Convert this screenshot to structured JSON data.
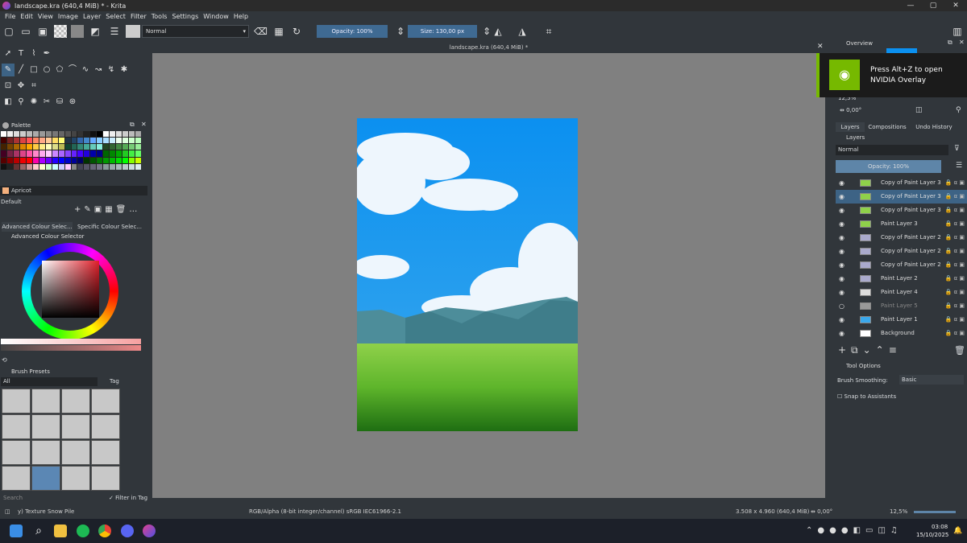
{
  "window": {
    "title": "landscape.kra (640,4 MiB) * - Krita",
    "min": "—",
    "max": "▢",
    "close": "✕"
  },
  "menu": [
    "File",
    "Edit",
    "View",
    "Image",
    "Layer",
    "Select",
    "Filter",
    "Tools",
    "Settings",
    "Window",
    "Help"
  ],
  "toolbar": {
    "blend_mode": "Normal",
    "opacity": "Opacity: 100%",
    "size": "Size: 130,00 px"
  },
  "canvas": {
    "tab_title": "landscape.kra (640,4 MiB) *"
  },
  "palette": {
    "title": "Palette",
    "selected_color": "Apricot",
    "palette_name": "Default"
  },
  "colour_tabs": {
    "tab1": "Advanced Colour Selec...",
    "tab2": "Specific Colour Selec..."
  },
  "adv_selector": {
    "title": "Advanced Colour Selector"
  },
  "brush_presets": {
    "title": "Brush Presets",
    "filter": "All",
    "tag": "Tag",
    "search_placeholder": "Search",
    "filter_in_tag": "Filter in Tag"
  },
  "overview": {
    "title": "Overview",
    "zoom": "12,5%",
    "rotation": "0,00°"
  },
  "right_tabs": [
    "Layers",
    "Compositions",
    "Undo History"
  ],
  "layers_panel": {
    "title": "Layers",
    "blend": "Normal",
    "opacity": "Opacity:  100%"
  },
  "layers": [
    {
      "name": "Copy of Paint Layer 3",
      "selected": false
    },
    {
      "name": "Copy of Paint Layer 3",
      "selected": true
    },
    {
      "name": "Copy of Paint Layer 3",
      "selected": false
    },
    {
      "name": "Paint Layer 3",
      "selected": false
    },
    {
      "name": "Copy of Paint Layer 2",
      "selected": false
    },
    {
      "name": "Copy of Paint Layer 2",
      "selected": false
    },
    {
      "name": "Copy of Paint Layer 2",
      "selected": false
    },
    {
      "name": "Paint Layer 2",
      "selected": false
    },
    {
      "name": "Paint Layer 4",
      "selected": false
    },
    {
      "name": "Paint Layer 5",
      "selected": false
    },
    {
      "name": "Paint Layer 1",
      "selected": false
    },
    {
      "name": "Background",
      "selected": false
    }
  ],
  "tool_options": {
    "title": "Tool Options",
    "smoothing_label": "Brush Smoothing:",
    "smoothing_value": "Basic",
    "snap": "Snap to Assistants"
  },
  "status": {
    "brush": "y) Texture Snow Pile",
    "color_space": "RGB/Alpha (8-bit integer/channel)  sRGB IEC61966-2.1",
    "dims": "3.508 x 4.960 (640,4 MiB)",
    "rotation": "0,00°",
    "zoom": "12,5%"
  },
  "nvidia": {
    "line1": "Press Alt+Z to open",
    "line2": "NVIDIA Overlay"
  },
  "clock": {
    "time": "03:08",
    "date": "15/10/2025"
  }
}
